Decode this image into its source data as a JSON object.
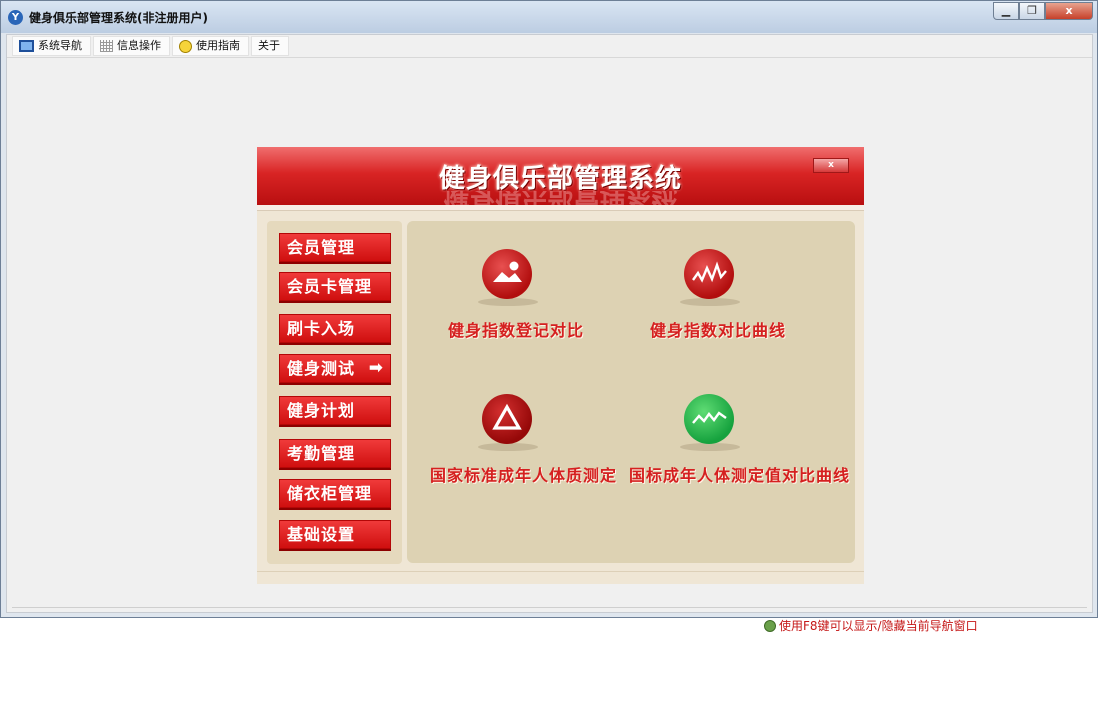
{
  "window": {
    "title": "健身俱乐部管理系统(非注册用户)",
    "icon": "app-logo-icon",
    "controls": {
      "minimize": "▁",
      "maximize": "❐",
      "close": "x"
    }
  },
  "menu": [
    {
      "label": "系统导航",
      "icon": "monitor-icon"
    },
    {
      "label": "信息操作",
      "icon": "grid-icon"
    },
    {
      "label": "使用指南",
      "icon": "smile-icon"
    },
    {
      "label": "关于",
      "icon": ""
    }
  ],
  "panel": {
    "title": "健身俱乐部管理系统",
    "close_label": "x",
    "nav": [
      {
        "label": "会员管理"
      },
      {
        "label": "会员卡管理"
      },
      {
        "label": "刷卡入场"
      },
      {
        "label": "健身测试",
        "arrow": "➡",
        "active": true
      },
      {
        "label": "健身计划"
      },
      {
        "label": "考勤管理"
      },
      {
        "label": "储衣柜管理"
      },
      {
        "label": "基础设置"
      }
    ],
    "functions": [
      {
        "label": "健身指数登记对比",
        "icon": "landscape-icon",
        "color": "#c31515"
      },
      {
        "label": "健身指数对比曲线",
        "icon": "zigzag-chart-icon",
        "color": "#c31515"
      },
      {
        "label": "国家标准成年人体质测定",
        "icon": "triangle-icon",
        "color": "#b31010"
      },
      {
        "label": "国标成年人体测定值对比曲线",
        "icon": "green-curve-icon",
        "color": "#23b04a"
      }
    ],
    "hint": "使用F8键可以显示/隐藏当前导航窗口"
  },
  "colors": {
    "accent_red": "#d52020",
    "panel_bg": "#efe6d5",
    "content_bg": "#ddd2b3"
  }
}
